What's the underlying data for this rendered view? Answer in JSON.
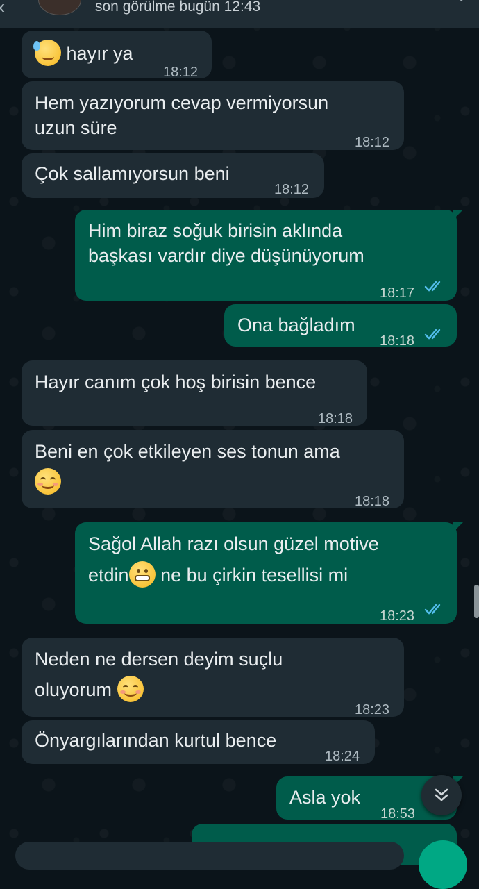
{
  "header": {
    "status": "son görülme bugün 12:43"
  },
  "messages": [
    {
      "dir": "in",
      "text": "hayır ya",
      "emoji_before": "sweat-smile",
      "time": "18:12"
    },
    {
      "dir": "in",
      "line1": "Hem yazıyorum cevap vermiyorsun",
      "line2": "uzun süre",
      "time": "18:12"
    },
    {
      "dir": "in",
      "text": "Çok sallamıyorsun beni",
      "time": "18:12"
    },
    {
      "dir": "out",
      "line1": "Him biraz soğuk birisin aklında",
      "line2": "başkası vardır diye düşünüyorum",
      "time": "18:17",
      "status": "read"
    },
    {
      "dir": "out",
      "text": "Ona bağladım",
      "time": "18:18",
      "status": "read"
    },
    {
      "dir": "in",
      "text": "Hayır canım çok hoş birisin bence",
      "time": "18:18"
    },
    {
      "dir": "in",
      "line1": "Beni en çok etkileyen ses tonun ama",
      "emoji_line2": "smiling-face",
      "time": "18:18"
    },
    {
      "dir": "out",
      "line1": "Sağol Allah razı olsun güzel motive",
      "line2a": "etdin",
      "emoji_mid": "grimacing-face",
      "line2b": "ne bu çirkin tesellisi mi",
      "time": "18:23",
      "status": "read"
    },
    {
      "dir": "in",
      "line1": "Neden ne dersen deyim suçlu",
      "line2": "oluyorum",
      "emoji_after": "smiling-face",
      "time": "18:23"
    },
    {
      "dir": "in",
      "text": "Önyargılarından kurtul bence",
      "time": "18:24"
    },
    {
      "dir": "out",
      "text": "Asla yok",
      "time": "18:53",
      "status": "read"
    }
  ],
  "colors": {
    "incoming": "#1f2c34",
    "outgoing": "#005c4b",
    "read_ticks": "#53bdeb",
    "background": "#0b141a"
  },
  "icons": {
    "scroll_down": "double-chevron-down-icon",
    "back": "back-arrow-icon",
    "menu": "more-vertical-icon"
  }
}
